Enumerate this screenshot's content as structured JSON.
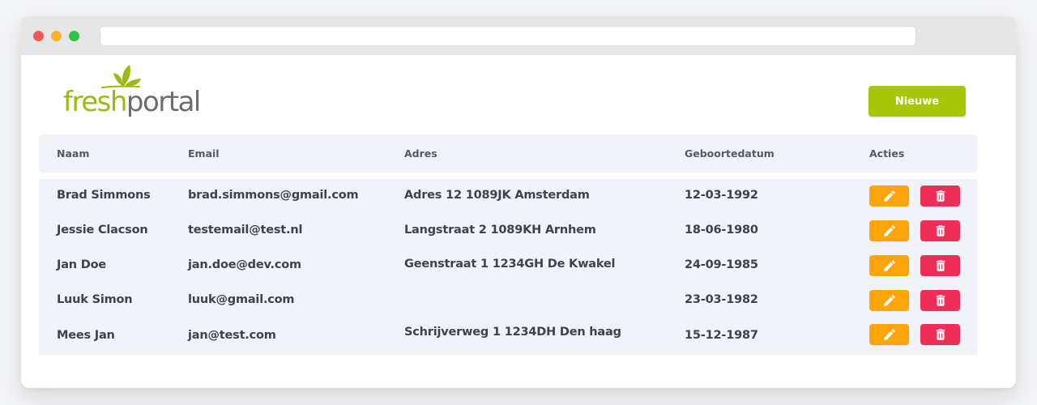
{
  "header": {
    "logo_fresh": "fresh",
    "logo_portal": "portal",
    "new_button_label": "Nieuwe"
  },
  "table": {
    "columns": [
      "Naam",
      "Email",
      "Adres",
      "Geboortedatum",
      "Acties"
    ],
    "rows": [
      {
        "naam": "Brad Simmons",
        "email": "brad.simmons@gmail.com",
        "adres": "Adres 12  1089JK Amsterdam",
        "geboortedatum": "12-03-1992"
      },
      {
        "naam": "Jessie Clacson",
        "email": "testemail@test.nl",
        "adres": "Langstraat 2  1089KH Arnhem",
        "geboortedatum": "18-06-1980"
      },
      {
        "naam": "Jan Doe",
        "email": "jan.doe@dev.com",
        "adres": "Geenstraat 1  1234GH De Kwakel",
        "geboortedatum": "24-09-1985"
      },
      {
        "naam": "Luuk Simon",
        "email": "luuk@gmail.com",
        "adres": "",
        "geboortedatum": "23-03-1982"
      },
      {
        "naam": "Mees Jan",
        "email": "jan@test.com",
        "adres": "Schrijverweg 1  1234DH Den haag",
        "geboortedatum": "15-12-1987"
      }
    ],
    "actions": {
      "edit_icon": "pencil-icon",
      "delete_icon": "trash-icon"
    }
  },
  "colors": {
    "brand_green": "#a8c70b",
    "logo_gray": "#6d6d6d",
    "edit_orange": "#ffa40b",
    "delete_red": "#f02d56",
    "table_bg": "#f0f3f7"
  }
}
